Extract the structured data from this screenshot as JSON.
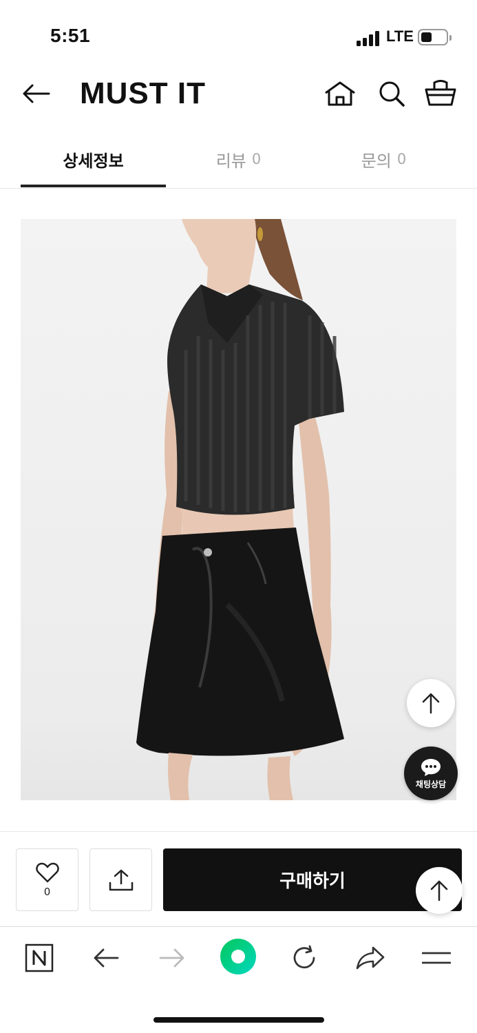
{
  "status_bar": {
    "time": "5:51",
    "network": "LTE",
    "icons": [
      "signal-icon",
      "battery-icon"
    ]
  },
  "header": {
    "logo": "MUST IT",
    "icons": [
      "back-arrow-icon",
      "home-icon",
      "search-icon",
      "cart-icon"
    ]
  },
  "tabs": [
    {
      "label": "상세정보",
      "count": ""
    },
    {
      "label": "리뷰",
      "count": "0"
    },
    {
      "label": "문의",
      "count": "0"
    }
  ],
  "product": {
    "image_icon": "product-photo-knit-polo-crop-top-leather-mini-skirt",
    "colors": {
      "top": "#2b2b2b",
      "skirt": "#151515",
      "skin": "#e8c9b5"
    }
  },
  "floating": {
    "scroll_top_icon": "arrow-up-icon",
    "chat_label": "채팅상담",
    "chat_icon": "chat-bubble-icon"
  },
  "action_bar": {
    "like_icon": "heart-icon",
    "like_count": "0",
    "share_icon": "share-upload-icon",
    "buy_label": "구매하기"
  },
  "browser_bar": {
    "icons": [
      "naver-n-icon",
      "back-arrow-icon",
      "forward-arrow-icon",
      "green-circle-home-icon",
      "reload-icon",
      "share-arrow-icon",
      "menu-icon"
    ],
    "accent": "#03c75a"
  }
}
